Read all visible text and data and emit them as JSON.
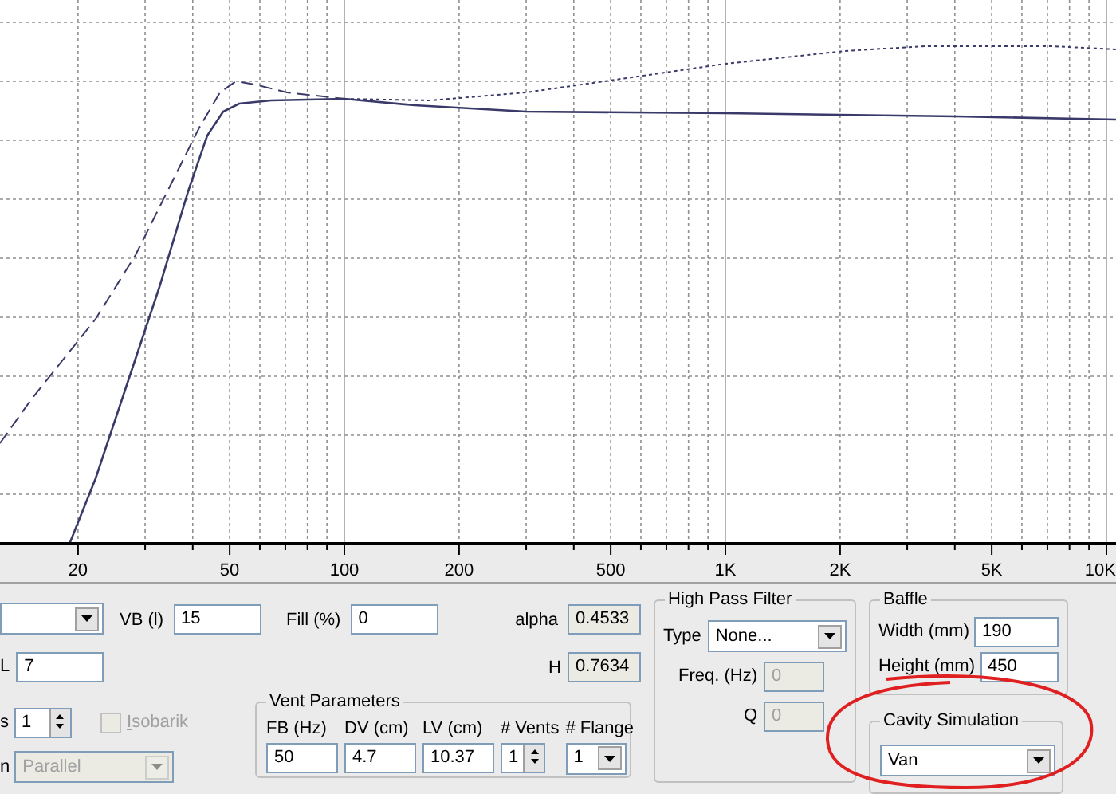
{
  "chart": {
    "x_axis_labels": [
      "20",
      "50",
      "100",
      "200",
      "500",
      "1K",
      "2K",
      "5K",
      "10K"
    ]
  },
  "box": {
    "vb": {
      "label": "VB (l)",
      "value": "15"
    },
    "fill": {
      "label": "Fill (%)",
      "value": "0"
    },
    "l": {
      "label": "L",
      "value": "7"
    },
    "count": {
      "label": "s",
      "value": "1"
    },
    "isobarik": {
      "label": "Isobarik",
      "checked": false,
      "disabled": true
    },
    "connection": {
      "label": "n",
      "value": "Parallel",
      "disabled": true
    }
  },
  "results": [
    {
      "label": "alpha",
      "value": "0.4533"
    },
    {
      "label": "H",
      "value": "0.7634"
    }
  ],
  "vent": {
    "title": "Vent Parameters",
    "fields": [
      {
        "label": "FB (Hz)",
        "value": "50",
        "kind": "text"
      },
      {
        "label": "DV (cm)",
        "value": "4.7",
        "kind": "text"
      },
      {
        "label": "LV (cm)",
        "value": "10.37",
        "kind": "text"
      },
      {
        "label": "# Vents",
        "value": "1",
        "kind": "spinner"
      },
      {
        "label": "# Flange",
        "value": "1",
        "kind": "dropdown"
      }
    ]
  },
  "high_pass": {
    "title": "High Pass Filter",
    "type": {
      "label": "Type",
      "value": "None..."
    },
    "freq": {
      "label": "Freq. (Hz)",
      "value": "0",
      "disabled": true
    },
    "q": {
      "label": "Q",
      "value": "0",
      "disabled": true
    }
  },
  "baffle": {
    "title": "Baffle",
    "fields": [
      {
        "label": "Width (mm)",
        "value": "190"
      },
      {
        "label": "Height (mm)",
        "value": "450"
      }
    ]
  },
  "cavity": {
    "title": "Cavity Simulation",
    "value": "Van",
    "highlighted": true
  }
}
